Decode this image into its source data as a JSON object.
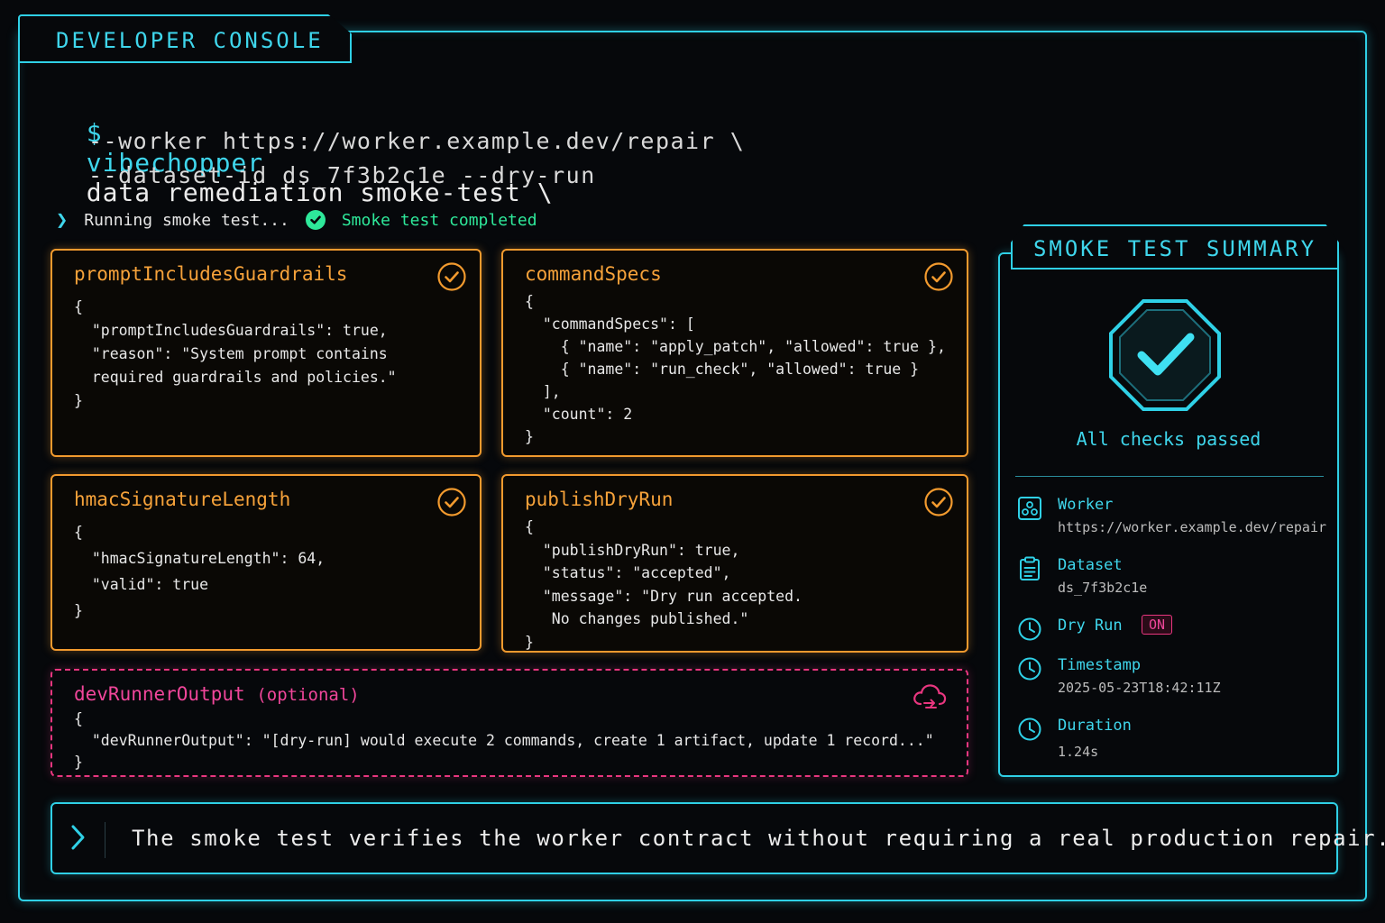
{
  "console": {
    "title": "DEVELOPER CONSOLE"
  },
  "command": {
    "prompt": "$",
    "app": "vibechopper",
    "line1_rest": "data remediation smoke-test \\",
    "line2": "--worker https://worker.example.dev/repair \\",
    "line3": "--dataset-id ds_7f3b2c1e --dry-run"
  },
  "status": {
    "running": "Running smoke test...",
    "completed": "Smoke test completed"
  },
  "cards": [
    {
      "title": "promptIncludesGuardrails",
      "body": "{\n  \"promptIncludesGuardrails\": true,\n  \"reason\": \"System prompt contains\n  required guardrails and policies.\"\n}"
    },
    {
      "title": "commandSpecs",
      "body": "{\n  \"commandSpecs\": [\n    { \"name\": \"apply_patch\", \"allowed\": true },\n    { \"name\": \"run_check\", \"allowed\": true }\n  ],\n  \"count\": 2\n}"
    },
    {
      "title": "hmacSignatureLength",
      "body": "{\n  \"hmacSignatureLength\": 64,\n  \"valid\": true\n}"
    },
    {
      "title": "publishDryRun",
      "body": "{\n  \"publishDryRun\": true,\n  \"status\": \"accepted\",\n  \"message\": \"Dry run accepted.\n   No changes published.\"\n}"
    }
  ],
  "optional_card": {
    "title": "devRunnerOutput",
    "suffix": "(optional)",
    "body": "{\n  \"devRunnerOutput\": \"[dry-run] would execute 2 commands, create 1 artifact, update 1 record...\"\n}"
  },
  "summary": {
    "title": "SMOKE TEST SUMMARY",
    "result": "All checks passed",
    "worker_label": "Worker",
    "worker_value": "https://worker.example.dev/repair",
    "dataset_label": "Dataset",
    "dataset_value": "ds_7f3b2c1e",
    "dryrun_label": "Dry Run",
    "dryrun_value": "ON",
    "timestamp_label": "Timestamp",
    "timestamp_value": "2025-05-23T18:42:11Z",
    "duration_label": "Duration",
    "duration_value": "1.24s"
  },
  "footer": {
    "text": "The smoke test verifies the worker contract without requiring a real production repair."
  },
  "colors": {
    "cyan": "#2fd0e6",
    "orange": "#f29a2e",
    "pink": "#e8367f",
    "green": "#2ee89a"
  }
}
